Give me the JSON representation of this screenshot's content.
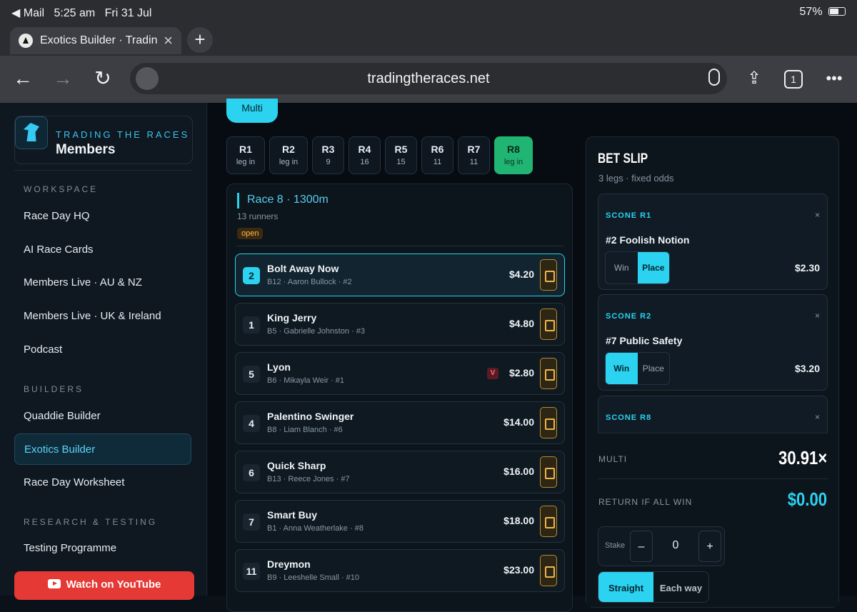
{
  "status": {
    "back_app": "◀ Mail",
    "time": "5:25 am",
    "date": "Fri 31 Jul",
    "battery": "57%"
  },
  "browser": {
    "tab_title": "Exotics Builder · Trading",
    "url": "tradingtheraces.net",
    "tab_count": "1"
  },
  "sidebar": {
    "brand_kicker": "TRADING THE RACES",
    "brand_name": "Members",
    "sections": {
      "workspace": "WORKSPACE",
      "builders": "BUILDERS",
      "research": "RESEARCH & TESTING"
    },
    "items": {
      "raceday_hq": "Race Day HQ",
      "ai_race_cards": "AI Race Cards",
      "members_live_au": "Members Live · AU & NZ",
      "members_live_uk": "Members Live · UK & Ireland",
      "podcast": "Podcast",
      "quaddie": "Quaddie Builder",
      "exotics": "Exotics Builder",
      "worksheet": "Race Day Worksheet",
      "testing": "Testing Programme"
    },
    "youtube_label": "Watch on YouTube"
  },
  "main": {
    "multi_tab": "Multi",
    "races": [
      {
        "label": "R1",
        "sub": "leg in"
      },
      {
        "label": "R2",
        "sub": "leg in"
      },
      {
        "label": "R3",
        "sub": "9"
      },
      {
        "label": "R4",
        "sub": "16"
      },
      {
        "label": "R5",
        "sub": "15"
      },
      {
        "label": "R6",
        "sub": "11"
      },
      {
        "label": "R7",
        "sub": "11"
      },
      {
        "label": "R8",
        "sub": "leg in"
      }
    ],
    "race": {
      "title": "Race 8 · 1300m",
      "runners_count": "13 runners",
      "status": "open"
    },
    "runners": [
      {
        "num": "2",
        "name": "Bolt Away Now",
        "meta": "B12 · Aaron Bullock · #2",
        "odds": "$4.20"
      },
      {
        "num": "1",
        "name": "King Jerry",
        "meta": "B5 · Gabrielle Johnston · #3",
        "odds": "$4.80"
      },
      {
        "num": "5",
        "name": "Lyon",
        "meta": "B6 · Mikayla Weir · #1",
        "odds": "$2.80",
        "badge": "V"
      },
      {
        "num": "4",
        "name": "Palentino Swinger",
        "meta": "B8 · Liam Blanch · #6",
        "odds": "$14.00"
      },
      {
        "num": "6",
        "name": "Quick Sharp",
        "meta": "B13 · Reece Jones · #7",
        "odds": "$16.00"
      },
      {
        "num": "7",
        "name": "Smart Buy",
        "meta": "B1 · Anna Weatherlake · #8",
        "odds": "$18.00"
      },
      {
        "num": "11",
        "name": "Dreymon",
        "meta": "B9 · Leeshelle Small · #10",
        "odds": "$23.00"
      }
    ]
  },
  "betslip": {
    "title": "BET SLIP",
    "subtitle": "3 legs · fixed odds",
    "legs": [
      {
        "label": "SCONE R1",
        "selection": "#2 Foolish Notion",
        "win": "Win",
        "place": "Place",
        "active": "place",
        "price": "$2.30",
        "close": "×"
      },
      {
        "label": "SCONE R2",
        "selection": "#7 Public Safety",
        "win": "Win",
        "place": "Place",
        "active": "win",
        "price": "$3.20",
        "close": "×"
      },
      {
        "label": "SCONE R8",
        "selection": "",
        "win": "",
        "place": "",
        "active": "",
        "price": "",
        "close": "×"
      }
    ],
    "multi_label": "MULTI",
    "multi_value": "30.91×",
    "return_label": "RETURN IF ALL WIN",
    "return_value": "$0.00",
    "stake_label": "Stake",
    "stake_value": "0",
    "minus": "–",
    "plus": "+",
    "mode_straight": "Straight",
    "mode_eachway": "Each way"
  }
}
